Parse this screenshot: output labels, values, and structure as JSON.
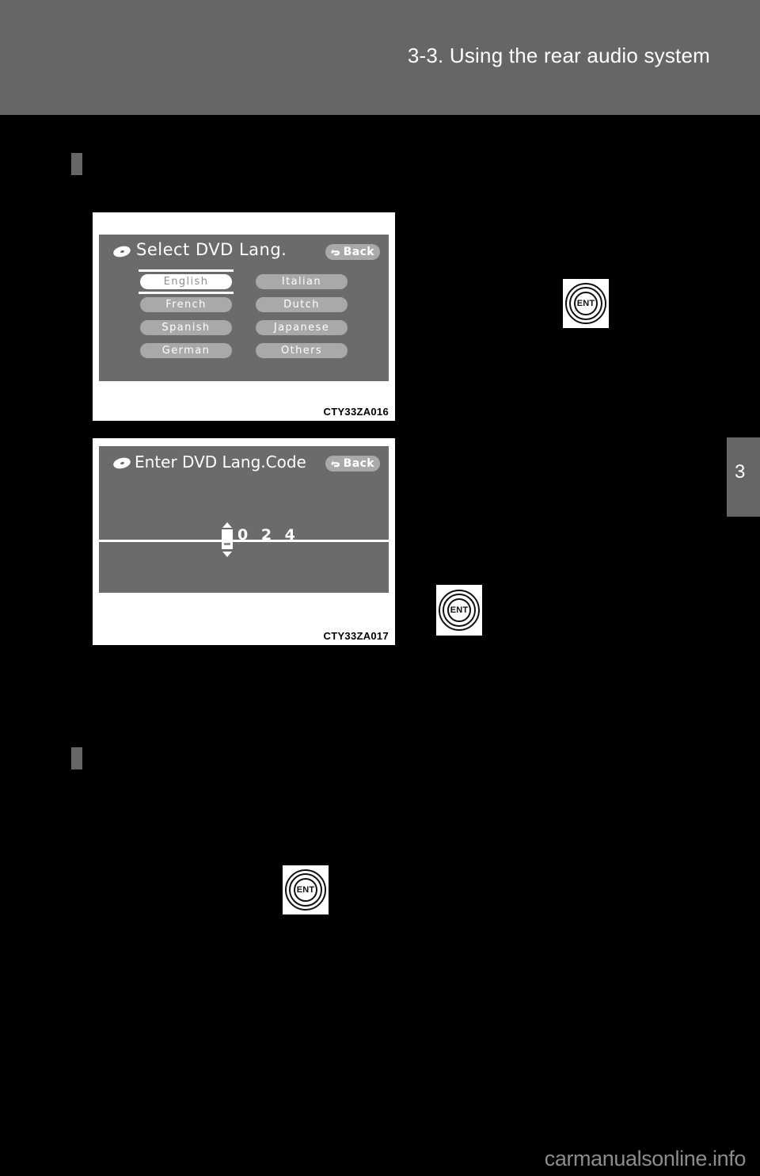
{
  "page": {
    "header_title": "3-3. Using the rear audio system",
    "chapter_number": "3",
    "watermark": "carmanualsonline.info"
  },
  "figures": [
    {
      "caption": "CTY33ZA016",
      "screen": {
        "title": "Select DVD Lang.",
        "disc_icon": "dvd-disc-icon",
        "back_button": {
          "label": "Back",
          "icon": "back-arrow-icon"
        },
        "options_left": [
          {
            "label": "English",
            "selected": true
          },
          {
            "label": "French",
            "selected": false
          },
          {
            "label": "Spanish",
            "selected": false
          },
          {
            "label": "German",
            "selected": false
          }
        ],
        "options_right": [
          {
            "label": "Italian",
            "selected": false
          },
          {
            "label": "Dutch",
            "selected": false
          },
          {
            "label": "Japanese",
            "selected": false
          },
          {
            "label": "Others",
            "selected": false
          }
        ]
      }
    },
    {
      "caption": "CTY33ZA017",
      "screen": {
        "title": "Enter DVD Lang.Code",
        "disc_icon": "dvd-disc-icon",
        "back_button": {
          "label": "Back",
          "icon": "back-arrow-icon"
        },
        "code_value": "0 2 4",
        "spinner_icon": "up-down-spinner-icon"
      }
    }
  ],
  "remote_buttons": [
    {
      "label": "ENT",
      "name": "ent-button-1"
    },
    {
      "label": "ENT",
      "name": "ent-button-2"
    },
    {
      "label": "ENT",
      "name": "ent-button-3"
    }
  ],
  "colors": {
    "header_band": "#666666",
    "screen_background": "#6b6b6b",
    "button_fill": "#a9a9a9",
    "selected_fill": "#ffffff",
    "page_background": "#000000"
  }
}
